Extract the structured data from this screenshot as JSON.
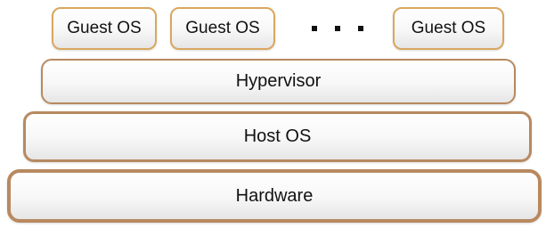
{
  "diagram": {
    "guest_os_boxes": [
      {
        "label": "Guest OS"
      },
      {
        "label": "Guest OS"
      },
      {
        "label": "Guest OS"
      }
    ],
    "layers": {
      "hypervisor": "Hypervisor",
      "host_os": "Host OS",
      "hardware": "Hardware"
    },
    "colors": {
      "guest_border": "#d9a760",
      "layer_border": "#b88960"
    }
  }
}
